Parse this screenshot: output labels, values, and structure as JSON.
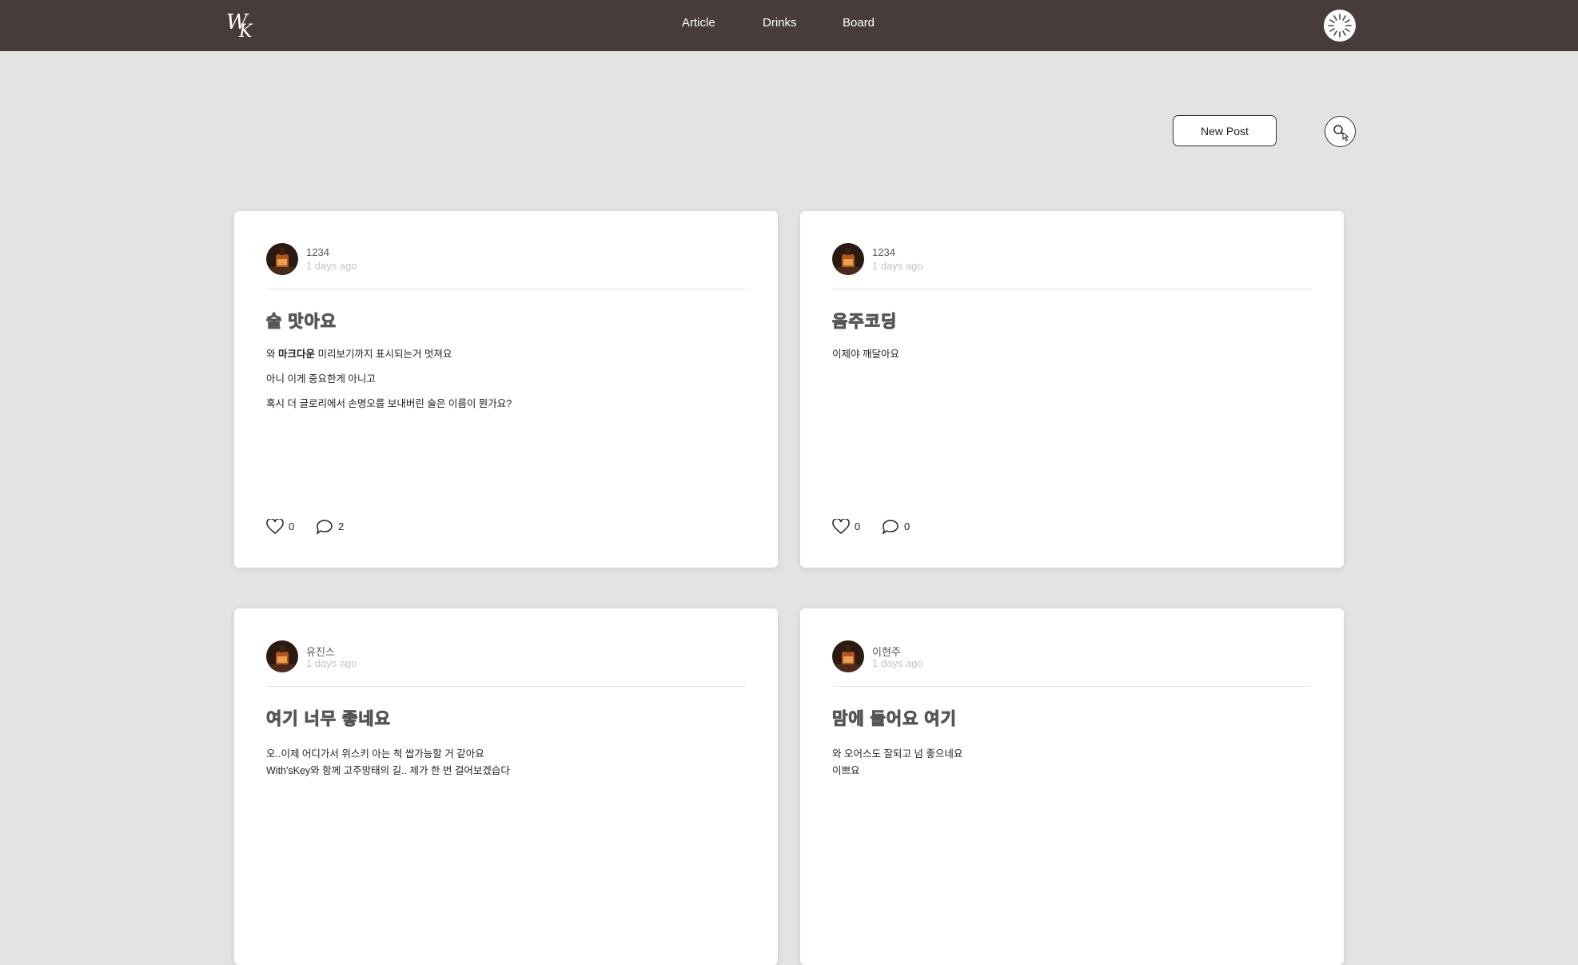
{
  "nav": {
    "logo_w": "W",
    "logo_k": "K",
    "links": [
      "Article",
      "Drinks",
      "Board"
    ]
  },
  "toolbar": {
    "new_post": "New Post"
  },
  "posts": [
    {
      "author": "1234",
      "time": "1 days ago",
      "title": "술 맛아요",
      "body": [
        {
          "pre": "와 ",
          "bold": "마크다운",
          "post": " 미리보기까지 표시되는거 멋져요"
        },
        {
          "pre": "아니 이게 중요한게 아니고",
          "bold": "",
          "post": ""
        },
        {
          "pre": "혹시 더 글로리에서 손명오를 보내버린 술은 이름이 뭔가요?",
          "bold": "",
          "post": ""
        }
      ],
      "likes": "0",
      "comments": "2"
    },
    {
      "author": "1234",
      "time": "1 days ago",
      "title": "음주코딩",
      "body": [
        {
          "pre": "이제야 깨달아요",
          "bold": "",
          "post": ""
        }
      ],
      "likes": "0",
      "comments": "0"
    },
    {
      "author": "유진스",
      "time": "1 days ago",
      "title": "여기 너무 좋네요",
      "body": [
        {
          "pre": "오..이제 어디가서 위스키 아는 척 쌉가능할 거 같아요",
          "bold": "",
          "post": ""
        },
        {
          "pre": "With'sKey와 함께 고주망태의 길.. 제가 한 번 걸어보겠습다",
          "bold": "",
          "post": ""
        }
      ],
      "likes": "",
      "comments": ""
    },
    {
      "author": "이현주",
      "time": "1 days ago",
      "title": "맘에 들어요 여기",
      "body": [
        {
          "pre": "와 오어스도 잘되고 넘 좋으네요",
          "bold": "",
          "post": ""
        },
        {
          "pre": "이쁘요",
          "bold": "",
          "post": ""
        }
      ],
      "likes": "",
      "comments": ""
    }
  ]
}
